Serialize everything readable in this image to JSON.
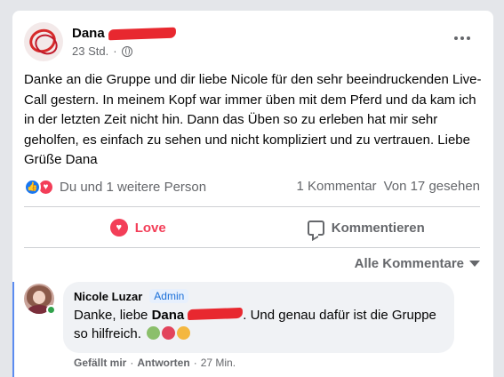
{
  "post": {
    "author": "Dana",
    "time": "23 Std.",
    "text": "Danke an die Gruppe und dir liebe Nicole für den sehr beeindruckenden Live-Call gestern. In meinem Kopf war immer üben mit dem Pferd und da kam ich in der letzten Zeit nicht hin. Dann das Üben so zu erleben hat mir sehr geholfen, es einfach zu sehen und nicht kompliziert und zu vertrauen. Liebe Grüße Dana",
    "reactors": "Du und 1 weitere Person",
    "comment_count": "1 Kommentar",
    "seen_by": "Von 17 gesehen"
  },
  "actions": {
    "love": "Love",
    "comment": "Kommentieren"
  },
  "sort_label": "Alle Kommentare",
  "comment": {
    "author": "Nicole Luzar",
    "badge": "Admin",
    "text_before": "Danke, liebe",
    "mention": "Dana",
    "text_after": ". Und genau dafür ist die Gruppe so hilfreich.",
    "like": "Gefällt mir",
    "separator": "·",
    "reply": "Antworten",
    "time": "27 Min."
  },
  "colors": {
    "accent": "#1877f2",
    "love": "#f33e58",
    "redaction": "#e8282f"
  },
  "icons": [
    "more-options-icon",
    "globe-icon",
    "like-reaction-icon",
    "love-reaction-icon",
    "love-icon",
    "comment-icon",
    "caret-down-icon"
  ]
}
